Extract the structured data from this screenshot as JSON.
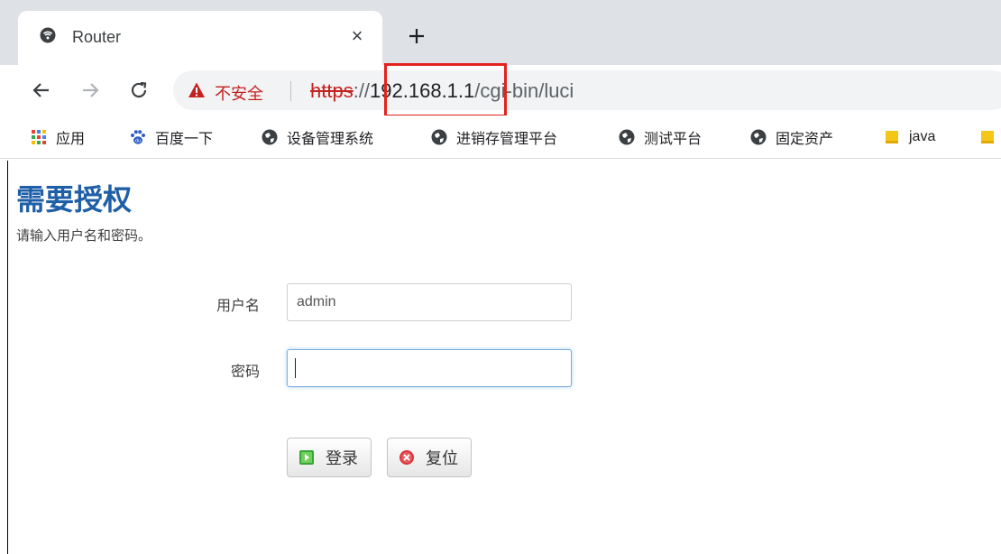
{
  "browser": {
    "tab": {
      "title": "Router",
      "close_glyph": "×",
      "favicon": "router-favicon-icon"
    },
    "new_tab_glyph": "+",
    "security_label": "不安全",
    "separator": "|",
    "url": {
      "scheme": "https",
      "sep": "://",
      "host": "192.168.1.1",
      "path": "/cgi-bin/luci"
    },
    "highlight_color": "#e3221b"
  },
  "bookmarks": [
    {
      "label": "应用",
      "icon": "apps-grid-icon"
    },
    {
      "label": "百度一下",
      "icon": "baidu-paw-icon"
    },
    {
      "label": "设备管理系统",
      "icon": "globe-icon"
    },
    {
      "label": "进销存管理平台",
      "icon": "globe-icon"
    },
    {
      "label": "测试平台",
      "icon": "globe-icon"
    },
    {
      "label": "固定资产",
      "icon": "globe-icon"
    },
    {
      "label": "java",
      "icon": "folder-icon"
    }
  ],
  "login": {
    "title": "需要授权",
    "description": "请输入用户名和密码。",
    "username_label": "用户名",
    "username_value": "admin",
    "password_label": "密码",
    "password_value": "",
    "login_button": "登录",
    "reset_button": "复位"
  },
  "colors": {
    "title_blue": "#1f5fa7",
    "insecure_red": "#c5221f",
    "login_icon_green": "#3aa63a",
    "reset_icon_red": "#d9363e"
  }
}
